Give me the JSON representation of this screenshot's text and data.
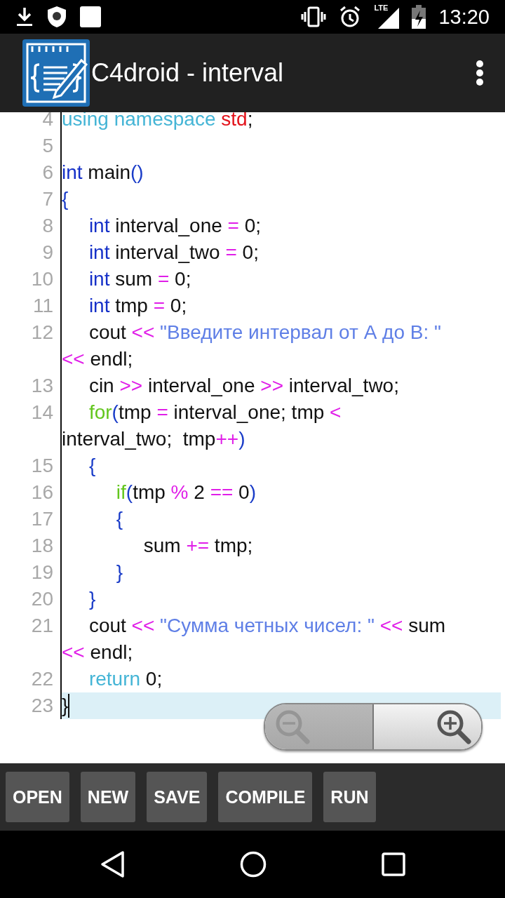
{
  "status_bar": {
    "network_type": "LTE",
    "time": "13:20"
  },
  "app_bar": {
    "title": "C4droid - interval"
  },
  "editor": {
    "lines": [
      {
        "number": "4",
        "current": false,
        "segments": [
          {
            "tokens": [
              {
                "kind": "directive",
                "text": "using namespace "
              },
              {
                "kind": "name-red",
                "text": "std"
              },
              {
                "kind": "plain",
                "text": ";"
              }
            ]
          }
        ]
      },
      {
        "number": "5",
        "current": false
      },
      {
        "number": "6",
        "current": false,
        "segments": [
          {
            "tokens": [
              {
                "kind": "type",
                "text": "int"
              },
              {
                "kind": "plain",
                "text": " main"
              },
              {
                "kind": "punct",
                "text": "()"
              }
            ]
          }
        ]
      },
      {
        "number": "7",
        "current": false,
        "segments": [
          {
            "tokens": [
              {
                "kind": "punct",
                "text": "{"
              }
            ]
          }
        ]
      },
      {
        "number": "8",
        "current": false,
        "segments": [
          {
            "tokens": [
              {
                "kind": "type",
                "text": "     int"
              },
              {
                "kind": "plain",
                "text": " interval_one "
              },
              {
                "kind": "op",
                "text": "="
              },
              {
                "kind": "plain",
                "text": " 0;"
              }
            ]
          }
        ]
      },
      {
        "number": "9",
        "current": false,
        "segments": [
          {
            "tokens": [
              {
                "kind": "type",
                "text": "     int"
              },
              {
                "kind": "plain",
                "text": " interval_two "
              },
              {
                "kind": "op",
                "text": "="
              },
              {
                "kind": "plain",
                "text": " 0;"
              }
            ]
          }
        ]
      },
      {
        "number": "10",
        "current": false,
        "segments": [
          {
            "tokens": [
              {
                "kind": "type",
                "text": "     int"
              },
              {
                "kind": "plain",
                "text": " sum "
              },
              {
                "kind": "op",
                "text": "="
              },
              {
                "kind": "plain",
                "text": " 0;"
              }
            ]
          }
        ]
      },
      {
        "number": "11",
        "current": false,
        "segments": [
          {
            "tokens": [
              {
                "kind": "type",
                "text": "     int"
              },
              {
                "kind": "plain",
                "text": " tmp "
              },
              {
                "kind": "op",
                "text": "="
              },
              {
                "kind": "plain",
                "text": " 0;"
              }
            ]
          }
        ]
      },
      {
        "number": "12",
        "current": false,
        "segments": [
          {
            "tokens": [
              {
                "kind": "plain",
                "text": "     cout "
              },
              {
                "kind": "op",
                "text": "<<"
              },
              {
                "kind": "string",
                "text": " \"Введите интервал от А до В: \""
              }
            ]
          },
          {
            "tokens": [
              {
                "kind": "op",
                "text": "<<"
              },
              {
                "kind": "plain",
                "text": " endl;"
              }
            ]
          }
        ]
      },
      {
        "number": "13",
        "current": false,
        "segments": [
          {
            "tokens": [
              {
                "kind": "plain",
                "text": "     cin "
              },
              {
                "kind": "op",
                "text": ">>"
              },
              {
                "kind": "plain",
                "text": " interval_one "
              },
              {
                "kind": "op",
                "text": ">>"
              },
              {
                "kind": "plain",
                "text": " interval_two;"
              }
            ]
          }
        ]
      },
      {
        "number": "14",
        "current": false,
        "segments": [
          {
            "tokens": [
              {
                "kind": "control",
                "text": "     for"
              },
              {
                "kind": "punct",
                "text": "("
              },
              {
                "kind": "plain",
                "text": "tmp "
              },
              {
                "kind": "op",
                "text": "="
              },
              {
                "kind": "plain",
                "text": " interval_one; tmp "
              },
              {
                "kind": "op",
                "text": "<"
              }
            ]
          },
          {
            "tokens": [
              {
                "kind": "plain",
                "text": "interval_two;  tmp"
              },
              {
                "kind": "op",
                "text": "++"
              },
              {
                "kind": "punct",
                "text": ")"
              }
            ]
          }
        ]
      },
      {
        "number": "15",
        "current": false,
        "segments": [
          {
            "tokens": [
              {
                "kind": "punct",
                "text": "     {"
              }
            ]
          }
        ]
      },
      {
        "number": "16",
        "current": false,
        "segments": [
          {
            "tokens": [
              {
                "kind": "control",
                "text": "          if"
              },
              {
                "kind": "punct",
                "text": "("
              },
              {
                "kind": "plain",
                "text": "tmp "
              },
              {
                "kind": "op",
                "text": "%"
              },
              {
                "kind": "plain",
                "text": " 2 "
              },
              {
                "kind": "op",
                "text": "=="
              },
              {
                "kind": "plain",
                "text": " 0"
              },
              {
                "kind": "punct",
                "text": ")"
              }
            ]
          }
        ]
      },
      {
        "number": "17",
        "current": false,
        "segments": [
          {
            "tokens": [
              {
                "kind": "punct",
                "text": "          {"
              }
            ]
          }
        ]
      },
      {
        "number": "18",
        "current": false,
        "segments": [
          {
            "tokens": [
              {
                "kind": "plain",
                "text": "               sum "
              },
              {
                "kind": "op",
                "text": "+="
              },
              {
                "kind": "plain",
                "text": " tmp;"
              }
            ]
          }
        ]
      },
      {
        "number": "19",
        "current": false,
        "segments": [
          {
            "tokens": [
              {
                "kind": "punct",
                "text": "          }"
              }
            ]
          }
        ]
      },
      {
        "number": "20",
        "current": false,
        "segments": [
          {
            "tokens": [
              {
                "kind": "punct",
                "text": "     }"
              }
            ]
          }
        ]
      },
      {
        "number": "21",
        "current": false,
        "segments": [
          {
            "tokens": [
              {
                "kind": "plain",
                "text": "     cout "
              },
              {
                "kind": "op",
                "text": "<<"
              },
              {
                "kind": "string",
                "text": " \"Сумма четных чисел: \" "
              },
              {
                "kind": "op",
                "text": "<<"
              },
              {
                "kind": "plain",
                "text": " sum"
              }
            ]
          },
          {
            "tokens": [
              {
                "kind": "op",
                "text": "<<"
              },
              {
                "kind": "plain",
                "text": " endl;"
              }
            ]
          }
        ]
      },
      {
        "number": "22",
        "current": false,
        "segments": [
          {
            "tokens": [
              {
                "kind": "directive",
                "text": "     return"
              },
              {
                "kind": "plain",
                "text": " 0;"
              }
            ]
          }
        ]
      },
      {
        "number": "23",
        "current": true,
        "segments": [
          {
            "tokens": [
              {
                "kind": "plain",
                "text": "}"
              }
            ]
          }
        ]
      }
    ]
  },
  "zoom_controls": [
    {
      "kind": "zoom-out",
      "disabled": true
    },
    {
      "kind": "zoom-in",
      "disabled": false
    }
  ],
  "buttons": [
    "OPEN",
    "NEW",
    "SAVE",
    "COMPILE",
    "RUN"
  ]
}
